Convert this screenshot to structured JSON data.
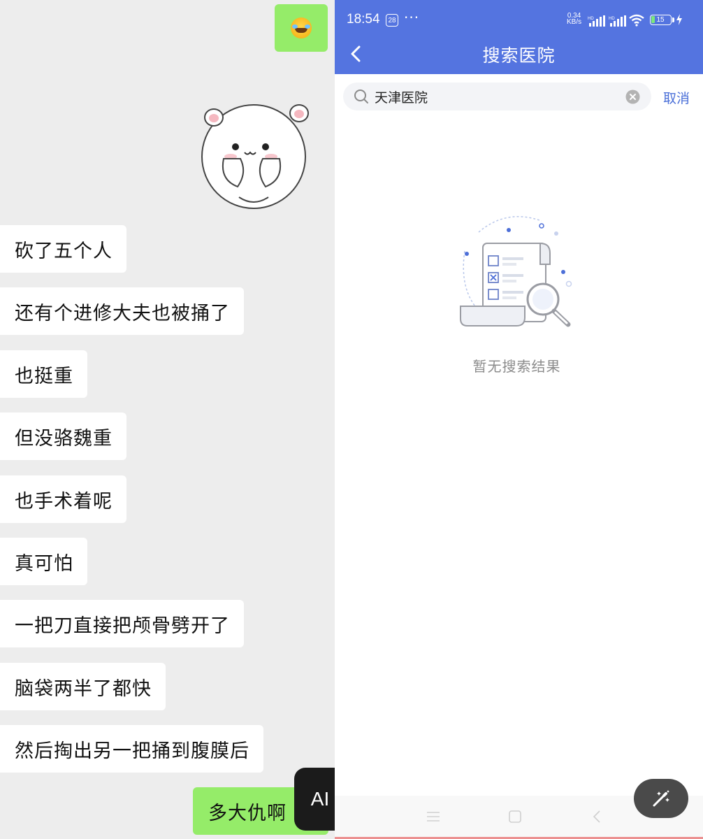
{
  "chat": {
    "messages_in": [
      "砍了五个人",
      "还有个进修大夫也被捅了",
      "也挺重",
      "但没骆魏重",
      "也手术着呢",
      "真可怕",
      "一把刀直接把颅骨劈开了",
      "脑袋两半了都快",
      "然后掏出另一把捅到腹膜后"
    ],
    "message_out_last": "多大仇啊",
    "ai_badge": "AI",
    "colors": {
      "bubble_out": "#95ec69",
      "bubble_in": "#ffffff",
      "background": "#ededed"
    }
  },
  "status_bar": {
    "time": "18:54",
    "badge": "28",
    "dots": "···",
    "net_speed_value": "0.34",
    "net_speed_unit": "KB/s",
    "battery": "15"
  },
  "header": {
    "title": "搜索医院",
    "color": "#5474e0"
  },
  "search": {
    "value": "天津医院",
    "cancel_label": "取消"
  },
  "empty_state": {
    "message": "暂无搜索结果"
  },
  "icons": {
    "back": "chevron-left-icon",
    "search": "search-icon",
    "clear": "clear-icon",
    "magic": "magic-wand-icon",
    "nav": [
      "menu-icon",
      "home-icon",
      "back-icon"
    ]
  }
}
